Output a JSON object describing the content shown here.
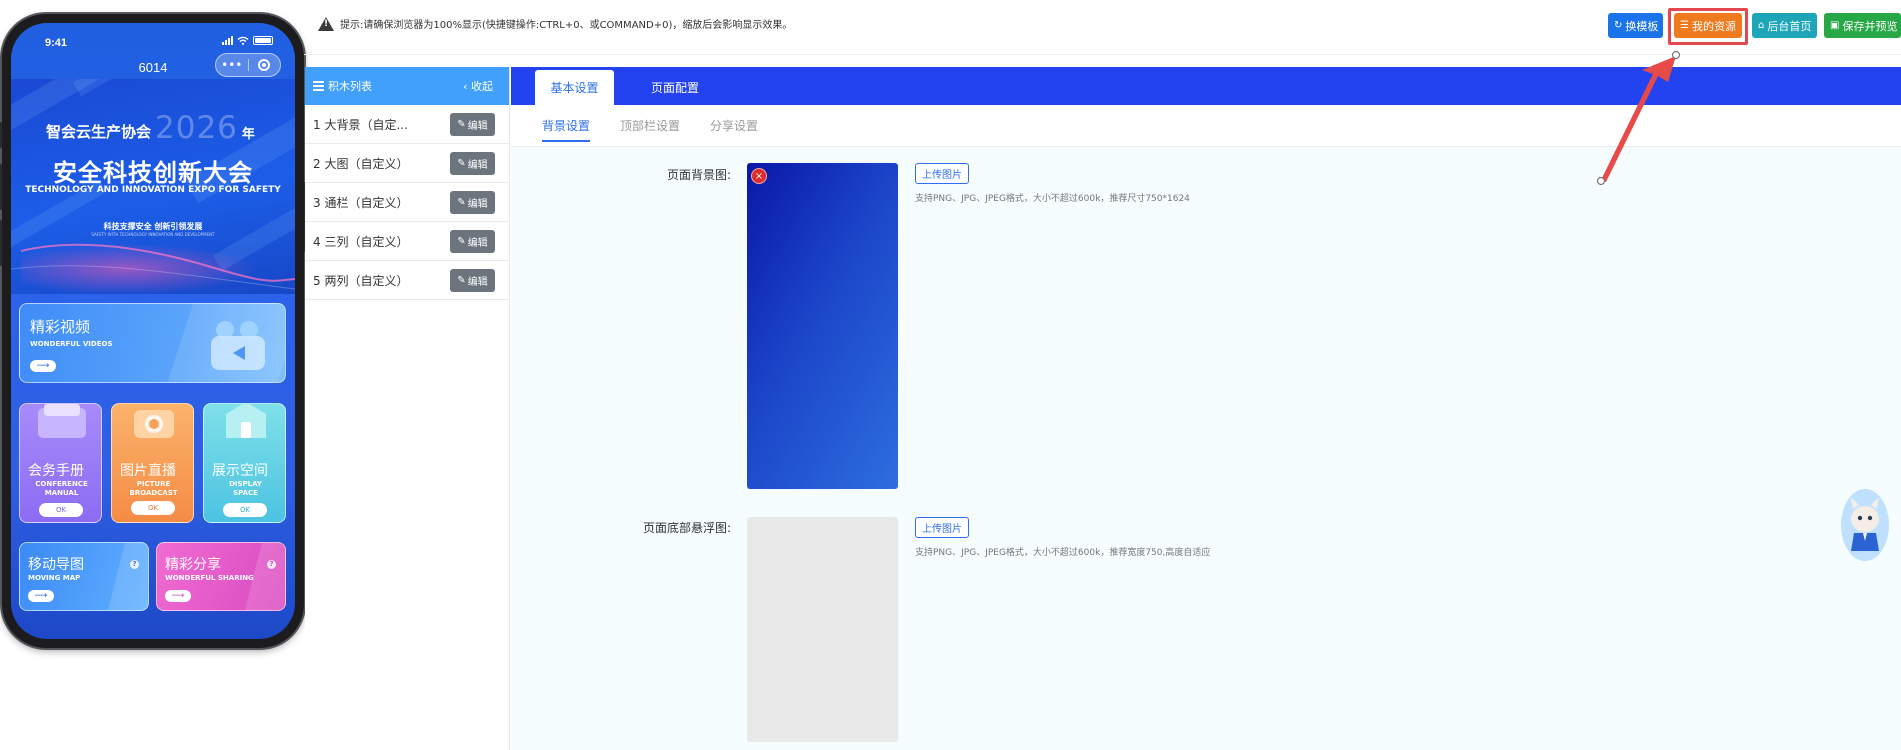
{
  "phone": {
    "status_time": "9:41",
    "app_title": "6014",
    "capsule_more": "•••",
    "banner": {
      "org": "智会云生产协会",
      "year": "2026",
      "year_suffix": "年",
      "title": "安全科技创新大会",
      "title_en": "TECHNOLOGY AND INNOVATION EXPO FOR SAFETY",
      "slogan": "科技支撑安全 创新引领发展",
      "slogan_en": "SAFETY WITH TECHNOLOGY INNOVATION AND DEVELOPMENT"
    },
    "video_tile": {
      "cn": "精彩视频",
      "en": "WONDERFUL VIDEOS",
      "arrow": "⟶"
    },
    "small_tiles": [
      {
        "cn": "会务手册",
        "en1": "CONFERENCE",
        "en2": "MANUAL",
        "ok": "OK"
      },
      {
        "cn": "图片直播",
        "en1": "PICTURE",
        "en2": "BROADCAST",
        "ok": "OK"
      },
      {
        "cn": "展示空间",
        "en1": "DISPLAY",
        "en2": "SPACE",
        "ok": "OK"
      }
    ],
    "bottom_tiles": [
      {
        "cn": "移动导图",
        "en": "MOVING MAP",
        "arrow": "⟶",
        "q": "?"
      },
      {
        "cn": "精彩分享",
        "en": "WONDERFUL SHARING",
        "arrow": "⟶",
        "q": "?"
      }
    ]
  },
  "topbar": {
    "tip": "提示:请确保浏览器为100%显示(快捷键操作:CTRL+0、或COMMAND+0)，缩放后会影响显示效果。",
    "buttons": {
      "template": {
        "label": "换模板",
        "icon": "↻",
        "color": "#1a73e8"
      },
      "resources": {
        "label": "我的资源",
        "icon": "☰",
        "color": "#f07a1e"
      },
      "home": {
        "label": "后台首页",
        "icon": "⌂",
        "color": "#1ea6b8"
      },
      "save": {
        "label": "保存并预览",
        "icon": "▣",
        "color": "#27a745"
      }
    }
  },
  "block_list": {
    "title": "积木列表",
    "collapse": "收起",
    "collapse_icon": "‹",
    "edit_label": "编辑",
    "edit_icon": "✎",
    "items": [
      {
        "label": "1 大背景（自定..."
      },
      {
        "label": "2 大图（自定义）"
      },
      {
        "label": "3 通栏（自定义）"
      },
      {
        "label": "4 三列（自定义）"
      },
      {
        "label": "5 两列（自定义）"
      }
    ]
  },
  "settings": {
    "tabs": [
      {
        "label": "基本设置",
        "active": true
      },
      {
        "label": "页面配置",
        "active": false
      }
    ],
    "subtabs": [
      {
        "label": "背景设置",
        "active": true
      },
      {
        "label": "顶部栏设置",
        "active": false
      },
      {
        "label": "分享设置",
        "active": false
      }
    ],
    "bg_field": {
      "label": "页面背景图:",
      "upload": "上传图片",
      "hint": "支持PNG、JPG、JPEG格式，大小不超过600k，推荐尺寸750*1624",
      "delete_icon": "×"
    },
    "float_field": {
      "label": "页面底部悬浮图:",
      "upload": "上传图片",
      "hint": "支持PNG、JPG、JPEG格式，大小不超过600k，推荐宽度750,高度自适应"
    }
  },
  "colors": {
    "accent_blue": "#2343f0",
    "list_header": "#41a0fb",
    "highlight_red": "#e4474d"
  }
}
